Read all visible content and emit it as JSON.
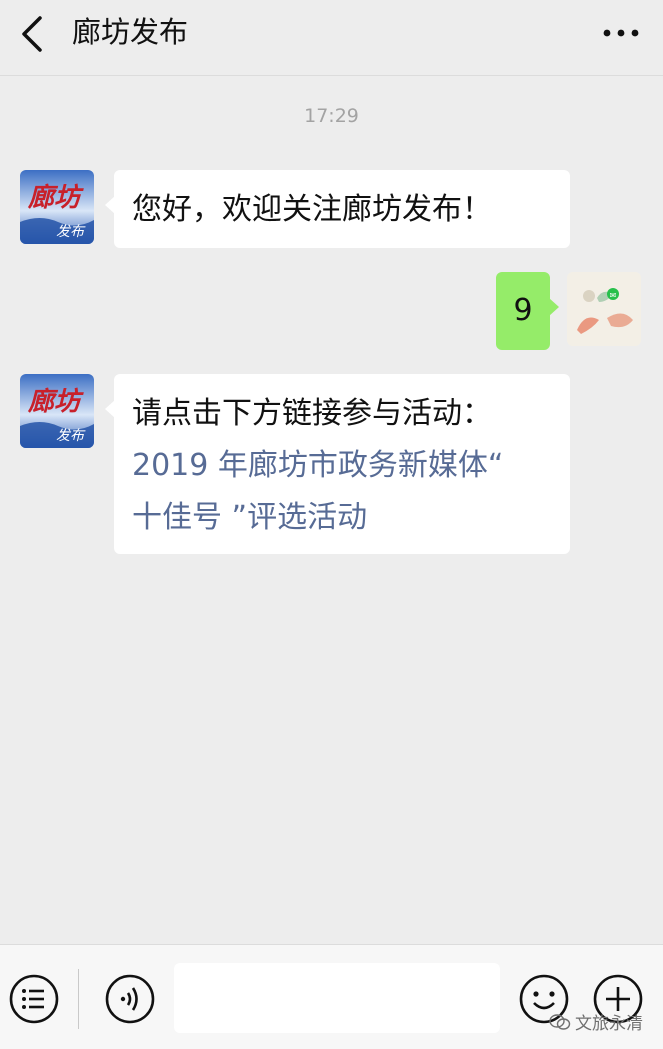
{
  "header": {
    "title": "廊坊发布",
    "back_icon": "chevron-left-icon",
    "more_icon": "more-dots-icon"
  },
  "chat": {
    "timestamp": "17:29",
    "messages": [
      {
        "sender": "official",
        "text": "您好，欢迎关注廊坊发布！"
      },
      {
        "sender": "user",
        "text": "9"
      },
      {
        "sender": "official",
        "text_line1": "请点击下方链接参与活动：",
        "link_line1": "2019 年廊坊市政务新媒体“",
        "link_line2": "十佳号 ”评选活动"
      }
    ],
    "avatar_text_top": "廊坊",
    "avatar_text_bottom": "发布"
  },
  "bottombar": {
    "menu_icon": "menu-list-icon",
    "voice_icon": "voice-icon",
    "emoji_icon": "emoji-icon",
    "plus_icon": "plus-icon",
    "input_value": ""
  },
  "watermark": {
    "text": "文旅永清"
  },
  "colors": {
    "background": "#ededed",
    "bubble_sent": "#95ec69",
    "bubble_received": "#ffffff",
    "link": "#576b95"
  }
}
